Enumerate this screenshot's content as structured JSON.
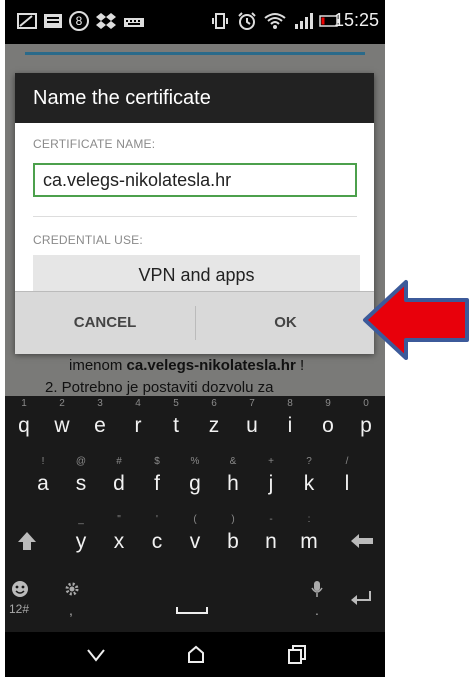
{
  "status_bar": {
    "time": "15:25",
    "notification_count": "8",
    "icons": [
      "gallery-icon",
      "message-icon",
      "notification-badge-icon",
      "dropbox-icon",
      "keyboard-icon",
      "vibrate-icon",
      "alarm-icon",
      "wifi-icon",
      "signal-icon",
      "battery-icon"
    ]
  },
  "background_app": {
    "line1_prefix": "imenom ",
    "line1_bold": "ca.velegs-nikolatesla.hr",
    "line1_suffix": " !",
    "line2": "2.  Potrebno je postaviti dozvolu za"
  },
  "dialog": {
    "title": "Name the certificate",
    "cert_label": "CERTIFICATE NAME:",
    "cert_value": "ca.velegs-nikolatesla.hr",
    "credential_label": "CREDENTIAL USE:",
    "credential_value": "VPN and apps",
    "cancel_label": "CANCEL",
    "ok_label": "OK"
  },
  "keyboard": {
    "row1": [
      {
        "main": "q",
        "sub": "1"
      },
      {
        "main": "w",
        "sub": "2"
      },
      {
        "main": "e",
        "sub": "3"
      },
      {
        "main": "r",
        "sub": "4"
      },
      {
        "main": "t",
        "sub": "5"
      },
      {
        "main": "z",
        "sub": "6"
      },
      {
        "main": "u",
        "sub": "7"
      },
      {
        "main": "i",
        "sub": "8"
      },
      {
        "main": "o",
        "sub": "9"
      },
      {
        "main": "p",
        "sub": "0"
      }
    ],
    "row2": [
      {
        "main": "a",
        "sub": "!"
      },
      {
        "main": "s",
        "sub": "@"
      },
      {
        "main": "d",
        "sub": "#"
      },
      {
        "main": "f",
        "sub": "$"
      },
      {
        "main": "g",
        "sub": "%"
      },
      {
        "main": "h",
        "sub": "&"
      },
      {
        "main": "j",
        "sub": "+"
      },
      {
        "main": "k",
        "sub": "?"
      },
      {
        "main": "l",
        "sub": "/"
      }
    ],
    "row3": [
      {
        "main": "y",
        "sub": "_"
      },
      {
        "main": "x",
        "sub": "\""
      },
      {
        "main": "c",
        "sub": "'"
      },
      {
        "main": "v",
        "sub": "("
      },
      {
        "main": "b",
        "sub": ")"
      },
      {
        "main": "n",
        "sub": "-"
      },
      {
        "main": "m",
        "sub": ":"
      }
    ],
    "shift_icon": "shift-icon",
    "backspace_icon": "backspace-icon",
    "symbols_label": "12#",
    "comma_label": ",",
    "period_label": ".",
    "space_icon": "space-icon",
    "enter_icon": "enter-icon",
    "settings_icon": "gear-icon",
    "mic_icon": "mic-icon",
    "emoji_icon": "emoji-icon"
  },
  "nav_bar": {
    "back_icon": "back-chevron-icon",
    "home_icon": "home-icon",
    "recents_icon": "recents-icon"
  },
  "colors": {
    "arrow_fill": "#e8000b",
    "arrow_stroke": "#3c5a9a",
    "input_border": "#4ca04c"
  }
}
